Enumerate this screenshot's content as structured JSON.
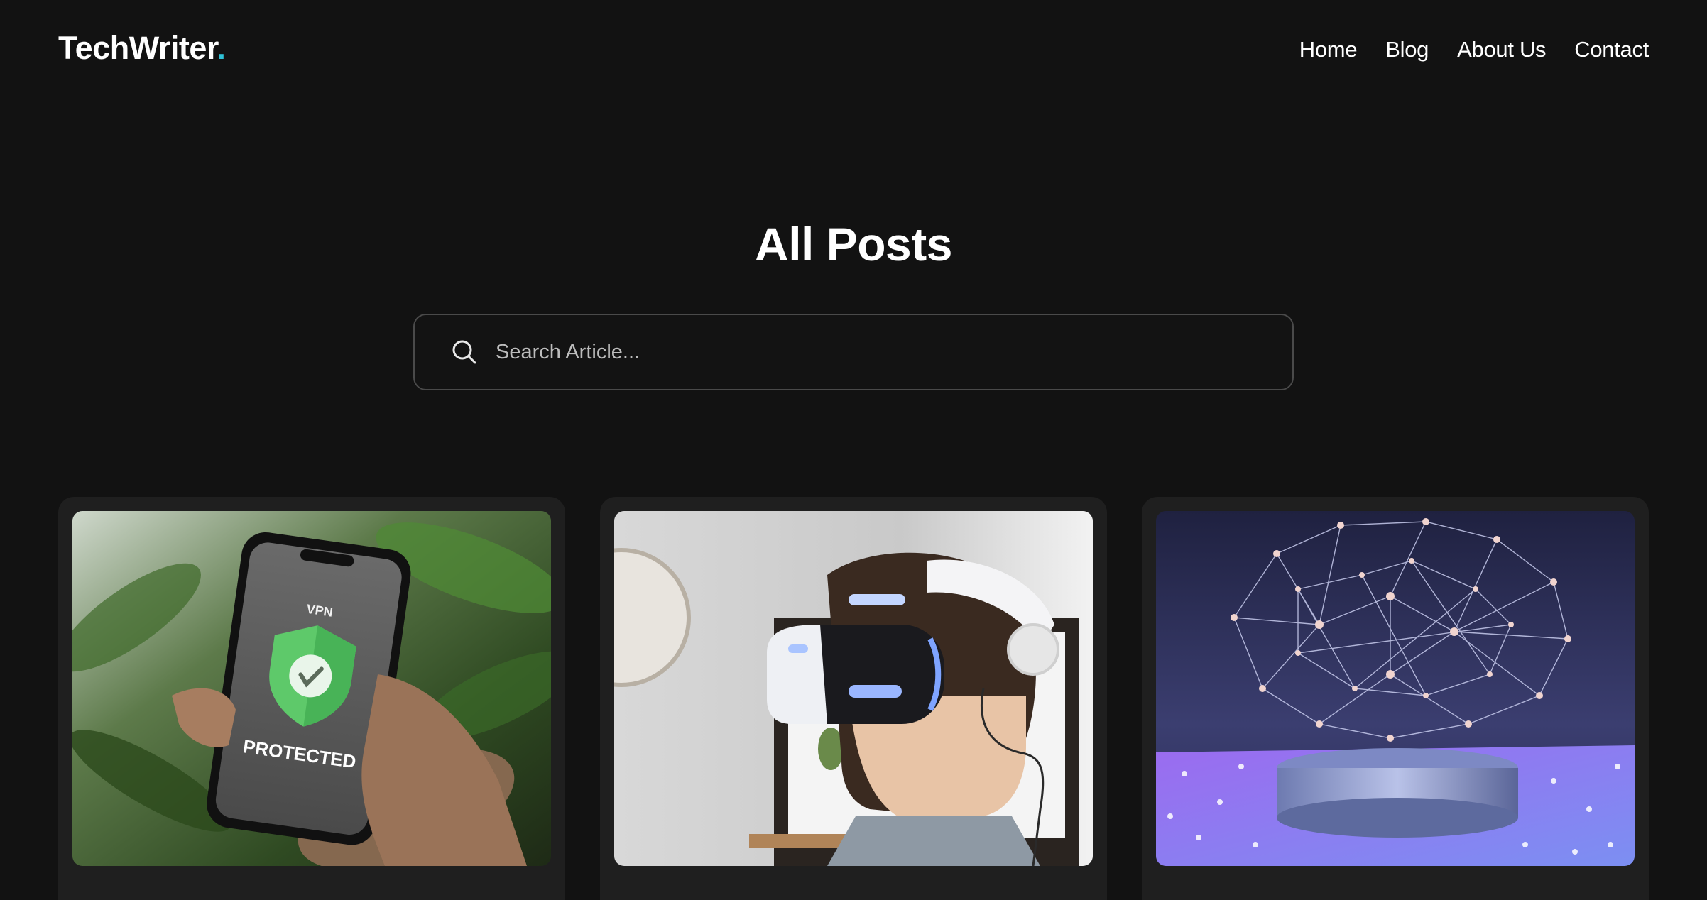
{
  "header": {
    "brand_text": "TechWriter",
    "brand_dot": ".",
    "nav": [
      {
        "label": "Home"
      },
      {
        "label": "Blog"
      },
      {
        "label": "About Us"
      },
      {
        "label": "Contact"
      }
    ]
  },
  "main": {
    "title": "All Posts",
    "search": {
      "placeholder": "Search Article...",
      "value": ""
    }
  },
  "posts": [
    {
      "image": {
        "alt": "VPN protected phone",
        "screen_top": "VPN",
        "screen_bottom": "PROTECTED"
      }
    },
    {
      "image": {
        "alt": "Child wearing VR headset"
      }
    },
    {
      "image": {
        "alt": "3D network brain"
      }
    }
  ],
  "colors": {
    "background": "#121212",
    "card": "#1f1f1f",
    "accent": "#2fc1d6",
    "border": "#4a4a4a"
  }
}
